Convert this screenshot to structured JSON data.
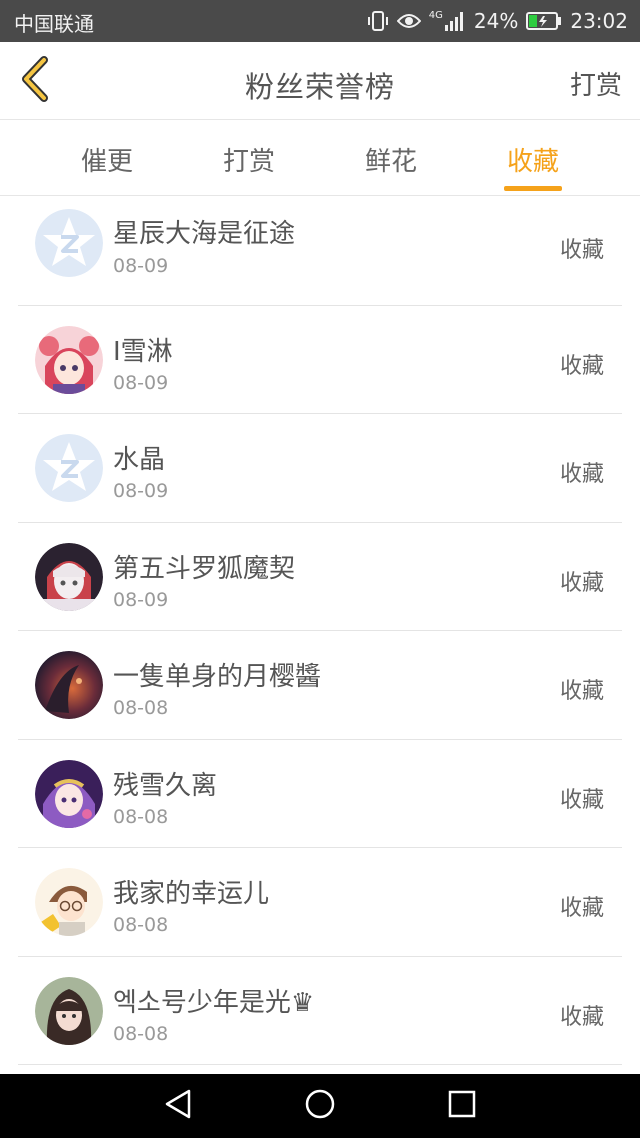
{
  "status_bar": {
    "carrier": "中国联通",
    "network": "4G",
    "battery": "24%",
    "time": "23:02",
    "icons": [
      "vibrate-icon",
      "eye-icon",
      "signal-icon",
      "battery-icon"
    ]
  },
  "header": {
    "title": "粉丝荣誉榜",
    "action": "打赏",
    "back_icon": "chevron-left-icon"
  },
  "tabs": [
    {
      "label": "催更",
      "active": false
    },
    {
      "label": "打赏",
      "active": false
    },
    {
      "label": "鲜花",
      "active": false
    },
    {
      "label": "收藏",
      "active": true
    }
  ],
  "colors": {
    "accent": "#f5a21a",
    "status_bar": "#4a4a4a",
    "nav_bar": "#000000"
  },
  "fans": [
    {
      "name": "星辰大海是征途",
      "date": "08-09",
      "action": "收藏",
      "avatar": "default-avatar"
    },
    {
      "name": "I雪淋",
      "date": "08-09",
      "action": "收藏",
      "avatar": "anime-avatar-pink"
    },
    {
      "name": "水晶",
      "date": "08-09",
      "action": "收藏",
      "avatar": "default-avatar"
    },
    {
      "name": "第五斗罗狐魔契",
      "date": "08-09",
      "action": "收藏",
      "avatar": "anime-avatar-white"
    },
    {
      "name": "一隻单身的月樱醬",
      "date": "08-08",
      "action": "收藏",
      "avatar": "dark-avatar"
    },
    {
      "name": "残雪久离",
      "date": "08-08",
      "action": "收藏",
      "avatar": "anime-avatar-purple"
    },
    {
      "name": "我家的幸运儿",
      "date": "08-08",
      "action": "收藏",
      "avatar": "anime-avatar-glasses"
    },
    {
      "name": "엑소号少年是光♛",
      "date": "08-08",
      "action": "收藏",
      "avatar": "photo-avatar"
    }
  ],
  "nav_bar": {
    "buttons": [
      "back-triangle-icon",
      "home-circle-icon",
      "recents-square-icon"
    ]
  }
}
